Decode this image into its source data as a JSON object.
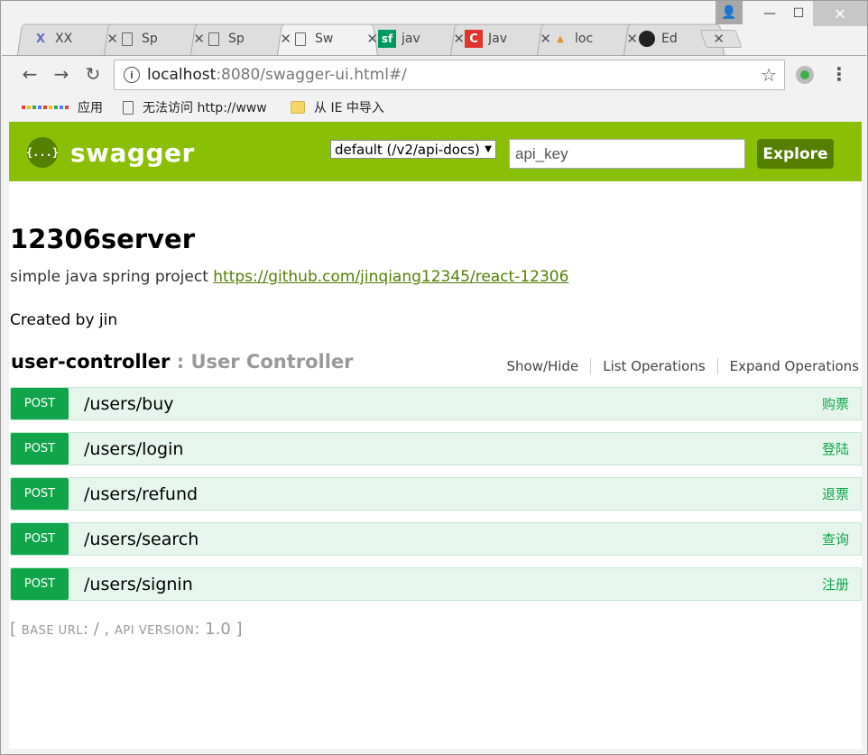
{
  "browser": {
    "tabs": [
      {
        "icon": "x-icon",
        "title": "XX"
      },
      {
        "icon": "doc-icon",
        "title": "Sp"
      },
      {
        "icon": "doc-icon",
        "title": "Sp"
      },
      {
        "icon": "doc-icon",
        "title": "Sw"
      },
      {
        "icon": "sf-icon",
        "title": "jav"
      },
      {
        "icon": "c-icon",
        "title": "Jav"
      },
      {
        "icon": "pma-icon",
        "title": "loc"
      },
      {
        "icon": "github-icon",
        "title": "Ed"
      }
    ],
    "url_host": "localhost",
    "url_rest": ":8080/swagger-ui.html#/",
    "bookmarks": {
      "apps": "应用",
      "item1": "无法访问 http://www",
      "item2": "从 IE 中导入"
    }
  },
  "swagger": {
    "logo_glyph": "{...}",
    "logo_text": "swagger",
    "spec_select": "default (/v2/api-docs)",
    "api_key_placeholder": "api_key",
    "explore_label": "Explore"
  },
  "info": {
    "title": "12306server",
    "description": "simple java spring project",
    "link": "https://github.com/jinqiang12345/react-12306",
    "contact": "Created by jin"
  },
  "resource": {
    "name": "user-controller",
    "description": ": User Controller",
    "links": {
      "show_hide": "Show/Hide",
      "list_ops": "List Operations",
      "expand_ops": "Expand Operations"
    }
  },
  "operations": [
    {
      "method": "POST",
      "path": "/users/buy",
      "summary": "购票"
    },
    {
      "method": "POST",
      "path": "/users/login",
      "summary": "登陆"
    },
    {
      "method": "POST",
      "path": "/users/refund",
      "summary": "退票"
    },
    {
      "method": "POST",
      "path": "/users/search",
      "summary": "查询"
    },
    {
      "method": "POST",
      "path": "/users/signin",
      "summary": "注册"
    }
  ],
  "footer": {
    "open": "[",
    "base_url_label": "base url",
    "base_url_value": ": / ,",
    "api_version_label": "api version",
    "api_version_value": ": 1.0",
    "close": "]"
  },
  "colors": {
    "swagger_green": "#89bf04",
    "post_green": "#10a54a",
    "dark_green": "#547f00"
  }
}
